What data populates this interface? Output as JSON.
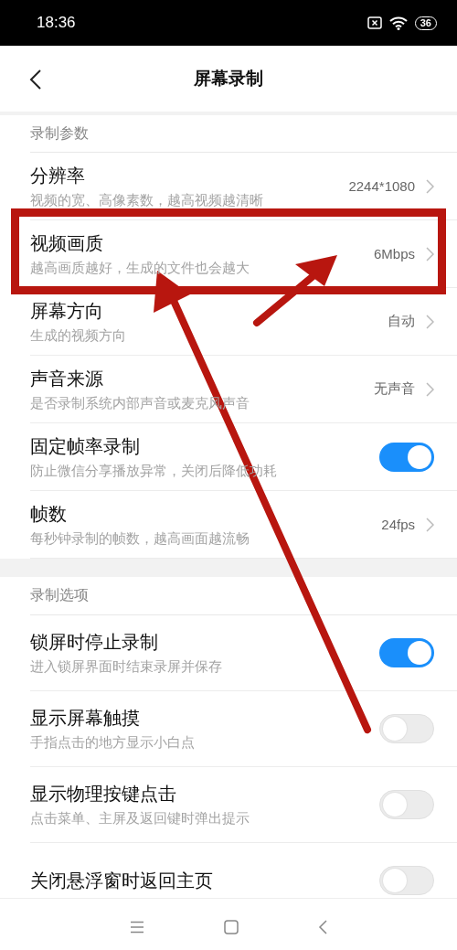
{
  "status_bar": {
    "time": "18:36",
    "battery": "36"
  },
  "header": {
    "title": "屏幕录制"
  },
  "sections": [
    {
      "title": "录制参数",
      "items": [
        {
          "kind": "value",
          "title": "分辨率",
          "subtitle": "视频的宽、高像素数，越高视频越清晰",
          "value": "2244*1080"
        },
        {
          "kind": "value",
          "title": "视频画质",
          "subtitle": "越高画质越好，生成的文件也会越大",
          "value": "6Mbps"
        },
        {
          "kind": "value",
          "title": "屏幕方向",
          "subtitle": "生成的视频方向",
          "value": "自动"
        },
        {
          "kind": "value",
          "title": "声音来源",
          "subtitle": "是否录制系统内部声音或麦克风声音",
          "value": "无声音"
        },
        {
          "kind": "toggle",
          "title": "固定帧率录制",
          "subtitle": "防止微信分享播放异常，关闭后降低功耗",
          "on": true
        },
        {
          "kind": "value",
          "title": "帧数",
          "subtitle": "每秒钟录制的帧数，越高画面越流畅",
          "value": "24fps"
        }
      ]
    },
    {
      "title": "录制选项",
      "items": [
        {
          "kind": "toggle",
          "title": "锁屏时停止录制",
          "subtitle": "进入锁屏界面时结束录屏并保存",
          "on": true
        },
        {
          "kind": "toggle",
          "title": "显示屏幕触摸",
          "subtitle": "手指点击的地方显示小白点",
          "on": false
        },
        {
          "kind": "toggle",
          "title": "显示物理按键点击",
          "subtitle": "点击菜单、主屏及返回键时弹出提示",
          "on": false
        },
        {
          "kind": "toggle",
          "title": "关闭悬浮窗时返回主页",
          "on": false
        }
      ]
    }
  ]
}
